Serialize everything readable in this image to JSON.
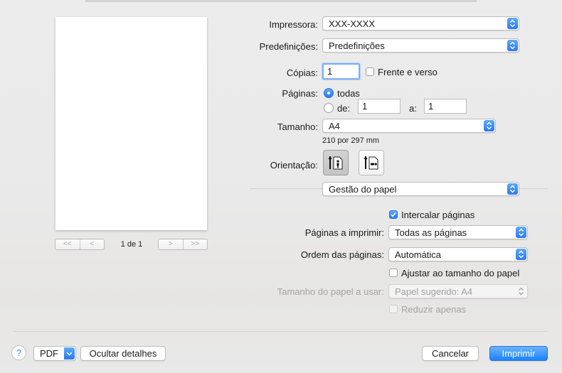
{
  "preview": {
    "page_count": "1 de 1",
    "nav": {
      "first": "<<",
      "prev": "<",
      "next": ">",
      "last": ">>"
    }
  },
  "printer": {
    "label": "Impressora:",
    "value": "XXX-XXXX"
  },
  "presets": {
    "label": "Predefinições:",
    "value": "Predefinições"
  },
  "copies": {
    "label": "Cópias:",
    "value": "1",
    "two_sided_label": "Frente e verso",
    "two_sided_checked": false
  },
  "pages": {
    "label": "Páginas:",
    "all_label": "todas",
    "all_selected": true,
    "from_label": "de:",
    "from_value": "1",
    "to_label": "a:",
    "to_value": "1"
  },
  "paper_size": {
    "label": "Tamanho:",
    "value": "A4",
    "dimensions": "210 por 297 mm"
  },
  "orientation": {
    "label": "Orientação:",
    "selected": "portrait",
    "icons": [
      "portrait-orientation-icon",
      "landscape-orientation-icon"
    ]
  },
  "section": {
    "value": "Gestão do papel"
  },
  "paper_handling": {
    "collate_label": "Intercalar páginas",
    "collate_checked": true,
    "pages_to_print_label": "Páginas a imprimir:",
    "pages_to_print_value": "Todas as páginas",
    "page_order_label": "Ordem das páginas:",
    "page_order_value": "Automática",
    "scale_to_fit_label": "Ajustar ao tamanho do papel",
    "scale_to_fit_checked": false,
    "dest_paper_label": "Tamanho do papel a usar:",
    "dest_paper_value": "Papel sugerido: A4",
    "scale_down_only_label": "Reduzir apenas",
    "scale_down_only_checked": false
  },
  "footer": {
    "help_label": "?",
    "pdf_label": "PDF",
    "hide_details_label": "Ocultar detalhes",
    "cancel_label": "Cancelar",
    "print_label": "Imprimir"
  },
  "colors": {
    "accent": "#2a78f0",
    "default_button": "#1a82fb"
  }
}
